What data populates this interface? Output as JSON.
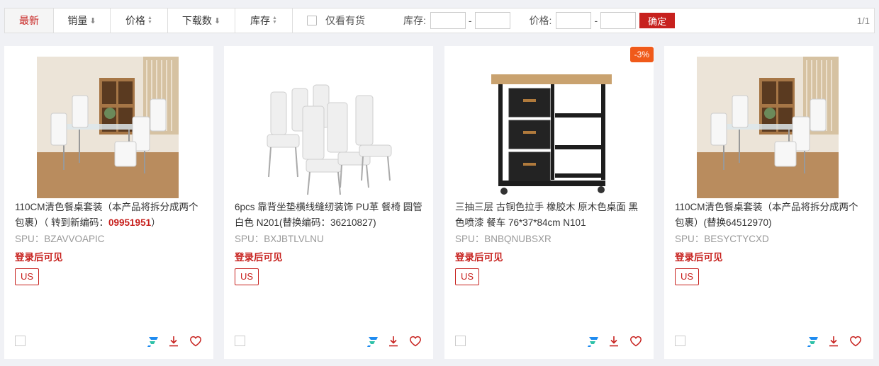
{
  "toolbar": {
    "sort_latest": "最新",
    "sort_sales": "销量",
    "sort_price": "价格",
    "sort_downloads": "下载数",
    "sort_stock": "库存",
    "in_stock_only": "仅看有货",
    "stock_label": "库存:",
    "price_label": "价格:",
    "dash": "-",
    "confirm": "确定",
    "pager": "1/1",
    "active_color": "#c7211e"
  },
  "products": [
    {
      "title": "110CM清色餐桌套装（本产品将拆分成两个包裹）（ 转到新编码：",
      "code": "09951951",
      "title_end": "）",
      "spu_label": "SPU：",
      "spu": "BZAVVOAPIC",
      "price_note": "登录后可见",
      "region": "US",
      "image": "dining-set-photo"
    },
    {
      "title": "6pcs 靠背坐垫横线缝纫装饰 PU革 餐椅 圆管 白色 N201(替换编码：36210827)",
      "spu_label": "SPU：",
      "spu": "BXJBTLVLNU",
      "price_note": "登录后可见",
      "region": "US",
      "image": "white-chairs-photo"
    },
    {
      "discount": "-3%",
      "title": "三抽三层 古铜色拉手 橡胶木 原木色桌面 黑色喷漆 餐车 76*37*84cm N101",
      "spu_label": "SPU：",
      "spu": "BNBQNUBSXR",
      "price_note": "登录后可见",
      "region": "US",
      "image": "kitchen-cart-photo"
    },
    {
      "title": "110CM清色餐桌套装（本产品将拆分成两个包裹）(替换64512970)",
      "spu_label": "SPU：",
      "spu": "BESYCTYCXD",
      "price_note": "登录后可见",
      "region": "US",
      "image": "dining-set-photo"
    }
  ]
}
